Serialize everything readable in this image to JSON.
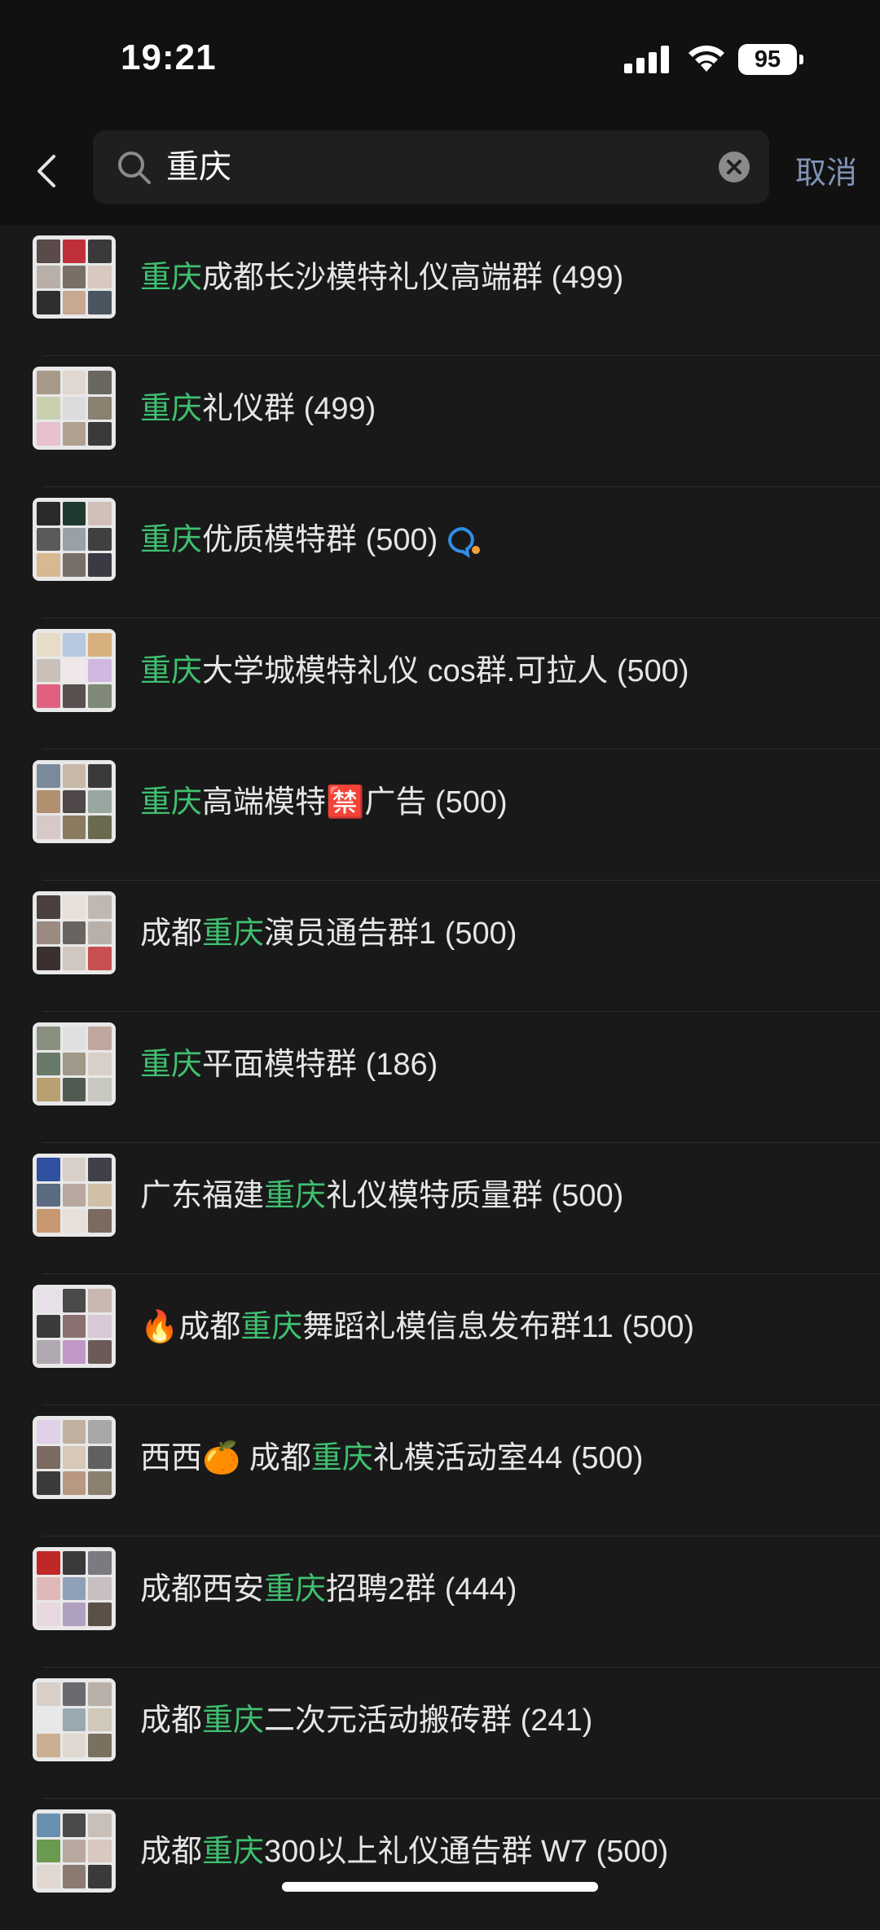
{
  "status": {
    "time": "19:21",
    "battery": "95"
  },
  "search": {
    "query": "重庆",
    "cancel_label": "取消"
  },
  "results": [
    {
      "pre": "",
      "kw": "重庆",
      "post": "成都长沙模特礼仪高端群 (499)"
    },
    {
      "pre": "",
      "kw": "重庆",
      "post": "礼仪群 (499)"
    },
    {
      "pre": "",
      "kw": "重庆",
      "post": "优质模特群 (500)"
    },
    {
      "pre": "",
      "kw": "重庆",
      "post": "大学城模特礼仪 cos群.可拉人 (500)"
    },
    {
      "pre": "",
      "kw": "重庆",
      "post_a": "高端模特",
      "emoji": "🈲",
      "post": "广告 (500)"
    },
    {
      "pre": "成都",
      "kw": "重庆",
      "post": "演员通告群1 (500)"
    },
    {
      "pre": "",
      "kw": "重庆",
      "post": "平面模特群 (186)"
    },
    {
      "pre": "广东福建",
      "kw": "重庆",
      "post": "礼仪模特质量群 (500)"
    },
    {
      "pre": "成都",
      "kw": "重庆",
      "post": "舞蹈礼模信息发布群11 (500)"
    },
    {
      "pre": "西西",
      "pre_b": " 成都",
      "kw": "重庆",
      "post": "礼模活动室44 (500)"
    },
    {
      "pre": "成都西安",
      "kw": "重庆",
      "post": "招聘2群 (444)"
    },
    {
      "pre": "成都",
      "kw": "重庆",
      "post": "二次元活动搬砖群 (241)"
    },
    {
      "pre": "成都",
      "kw": "重庆",
      "post": "300以上礼仪通告群 W7 (500)"
    }
  ],
  "colors": {
    "background": "#191919",
    "header": "#111111",
    "highlight": "#3fc070",
    "cancel": "#7f93b6"
  },
  "icons": [
    "back-icon",
    "search-icon",
    "clear-icon",
    "group-chat-icon",
    "fire-icon",
    "orange-icon",
    "prohibited-emoji"
  ]
}
